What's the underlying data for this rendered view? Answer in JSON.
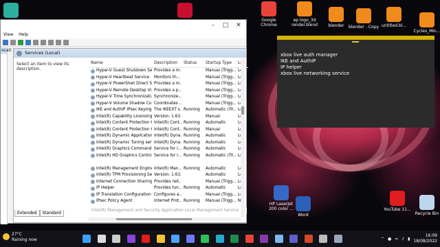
{
  "window": {
    "menu": [
      "View",
      "Help"
    ],
    "left_label": "ocal)",
    "pane_title": "Services (Local)",
    "description_text": "Select an item to view its description.",
    "columns": [
      "Name",
      "Description",
      "Status",
      "Startup Type",
      "Log"
    ],
    "rows": [
      [
        "Hyper-V Guest Shutdown Se...",
        "Provides a m...",
        "",
        "Manual (Trigg...",
        "Loc"
      ],
      [
        "Hyper-V Heartbeat Service",
        "Monitors th...",
        "",
        "Manual (Trigg...",
        "Loc"
      ],
      [
        "Hyper-V PowerShell Direct S...",
        "Provides a m...",
        "",
        "Manual (Trigg...",
        "Loc"
      ],
      [
        "Hyper-V Remote Desktop Vi...",
        "Provides a p...",
        "",
        "Manual (Trigg...",
        "Loc"
      ],
      [
        "Hyper-V Time Synchronizati...",
        "Synchronize...",
        "",
        "Manual (Trigg...",
        "Loc"
      ],
      [
        "Hyper-V Volume Shadow Co...",
        "Coordinates ...",
        "",
        "Manual (Trigg...",
        "Loc"
      ],
      [
        "IKE and AuthIP IPsec Keying ...",
        "The IKEEXT s...",
        "Running",
        "Automatic (Tri...",
        "Loc"
      ],
      [
        "Intel(R) Capability Licensing ...",
        "Version: 1.63...",
        "",
        "Manual",
        "Loc"
      ],
      [
        "Intel(R) Content Protection H...",
        "Intel(R) Cont...",
        "Running",
        "Automatic",
        "Loc"
      ],
      [
        "Intel(R) Content Protection H...",
        "Intel(R) Cont...",
        "Running",
        "Manual",
        "Loc"
      ],
      [
        "Intel(R) Dynamic Application...",
        "Intel(R) Dyna...",
        "Running",
        "Automatic",
        "Loc"
      ],
      [
        "Intel(R) Dynamic Tuning serv...",
        "Intel(R) Dyna...",
        "Running",
        "Automatic",
        "Loc"
      ],
      [
        "Intel(R) Graphics Command ...",
        "Service for I...",
        "Running",
        "Automatic",
        "Loc"
      ],
      [
        "Intel(R) HD Graphics Control ...",
        "Service for I...",
        "Running",
        "Automatic (Tri...",
        "Loc"
      ],
      [
        "",
        "",
        "",
        "",
        ""
      ],
      [
        "Intel(R) Management Engine...",
        "Intel(R) Man...",
        "Running",
        "Automatic",
        "Loc"
      ],
      [
        "Intel(R) TPM Provisioning Se...",
        "Version: 1.63...",
        "",
        "Automatic",
        "Loc"
      ],
      [
        "Internet Connection Sharing...",
        "Provides net...",
        "",
        "Manual (Trigg...",
        "Loc"
      ],
      [
        "IP Helper",
        "Provides tun...",
        "Running",
        "Automatic",
        "Loc"
      ],
      [
        "IP Translation Configuration ...",
        "Configures a...",
        "",
        "Manual (Trigg...",
        "Loc"
      ],
      [
        "IPsec Policy Agent",
        "Internet Prot...",
        "Running",
        "Manual (Trigg...",
        "Ne"
      ]
    ],
    "tooltip": "Intel(R) Management and Security Application Local Management Service",
    "tabs": [
      "Extended",
      "Standard"
    ]
  },
  "clipboard": {
    "items": [
      "xbox live auth manager",
      "IKE and AuthIP",
      "IP helper",
      "xbox live networking service"
    ]
  },
  "desktop_icons": [
    {
      "label": "Google Chrome",
      "icon": "chrome-icon",
      "color": "#e8443a"
    },
    {
      "label": "ep logo_3d render.blend",
      "icon": "blender-file-icon",
      "color": "#f08a1c"
    },
    {
      "label": "blender",
      "icon": "blender-icon",
      "color": "#f08a1c"
    },
    {
      "label": "blender - Copy",
      "icon": "blender-icon",
      "color": "#f08a1c"
    },
    {
      "label": "untitled.bl...",
      "icon": "blender-file-icon",
      "color": "#f08a1c"
    },
    {
      "label": "Cycles_Min...",
      "icon": "blender-file-icon",
      "color": "#f08a1c"
    },
    {
      "label": "HP LaserJet 200 color ...",
      "icon": "printer-icon",
      "color": "#3568c9"
    },
    {
      "label": "Word",
      "icon": "word-icon",
      "color": "#2b5fb8"
    },
    {
      "label": "YouTube 11...",
      "icon": "youtube-icon",
      "color": "#e01e1e"
    },
    {
      "label": "Recycle Bin",
      "icon": "recycle-bin-icon",
      "color": "#bcd6ee"
    }
  ],
  "weather": {
    "temp": "27°C",
    "desc": "Raining now"
  },
  "clock": {
    "time": "16:09",
    "date": "18/08/2022"
  },
  "taskbar_icons": [
    {
      "name": "start-icon",
      "color": "#3aa0ff"
    },
    {
      "name": "search-icon",
      "color": "#dddddd"
    },
    {
      "name": "task-view-icon",
      "color": "#cccccc"
    },
    {
      "name": "media-icon",
      "color": "#8a44d8"
    },
    {
      "name": "youtube-icon",
      "color": "#e01e1e"
    },
    {
      "name": "file-explorer-icon",
      "color": "#f2c43a"
    },
    {
      "name": "store-icon",
      "color": "#4da3ff"
    },
    {
      "name": "discord-icon",
      "color": "#6c7bf5"
    },
    {
      "name": "whatsapp-icon",
      "color": "#2fbe5b"
    },
    {
      "name": "edge-icon",
      "color": "#2aa8c9"
    },
    {
      "name": "excel-icon",
      "color": "#1f8a4c"
    },
    {
      "name": "chrome-icon",
      "color": "#e8443a"
    },
    {
      "name": "onenote-icon",
      "color": "#8a3aa8"
    },
    {
      "name": "notepad-icon",
      "color": "#7fb6f0"
    },
    {
      "name": "teams-icon",
      "color": "#5b61c8"
    },
    {
      "name": "powerpoint-icon",
      "color": "#d04a26"
    },
    {
      "name": "settings-icon",
      "color": "#bbbbbb"
    },
    {
      "name": "services-icon",
      "color": "#9aa7b8"
    }
  ]
}
